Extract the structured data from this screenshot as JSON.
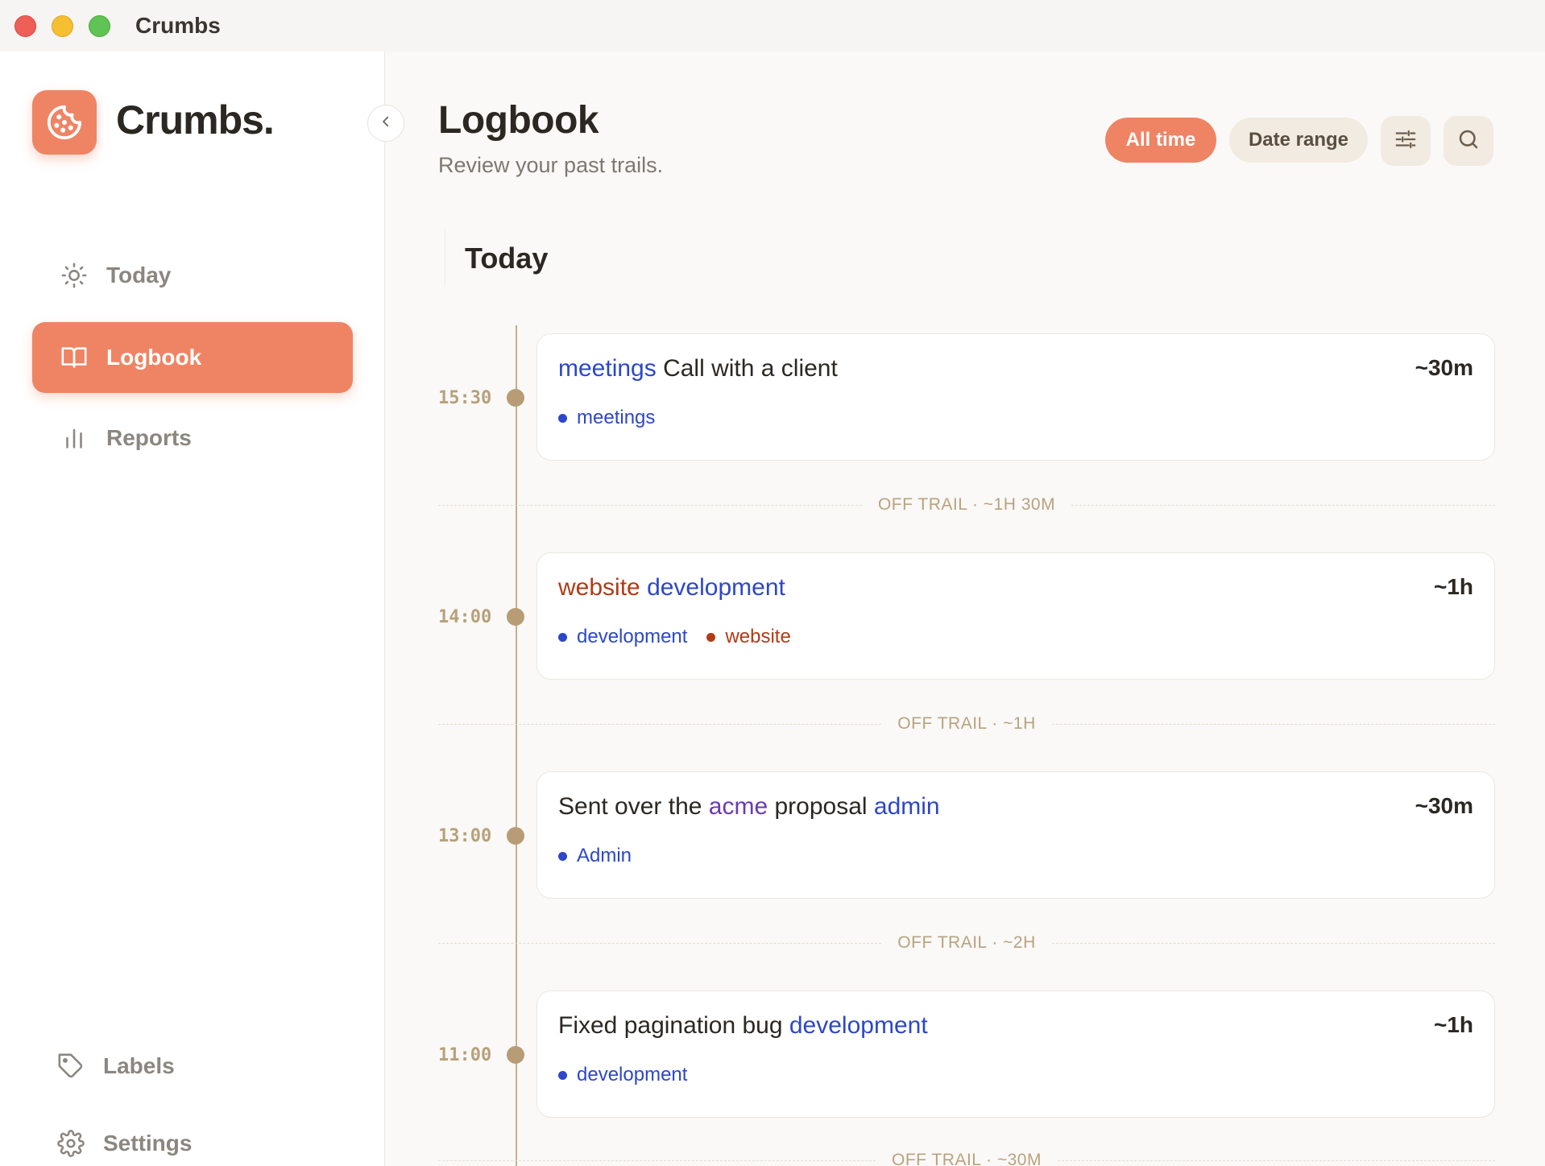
{
  "window": {
    "title": "Crumbs"
  },
  "sidebar": {
    "brand": "Crumbs.",
    "items": [
      {
        "label": "Today",
        "icon": "sun-icon",
        "active": false
      },
      {
        "label": "Logbook",
        "icon": "book-icon",
        "active": true
      },
      {
        "label": "Reports",
        "icon": "bar-chart-icon",
        "active": false
      }
    ],
    "bottom": [
      {
        "label": "Labels",
        "icon": "tag-icon"
      },
      {
        "label": "Settings",
        "icon": "gear-icon"
      }
    ]
  },
  "header": {
    "title": "Logbook",
    "subtitle": "Review your past trails.",
    "filters": {
      "all_time": "All time",
      "date_range": "Date range"
    }
  },
  "section": {
    "title": "Today"
  },
  "entries": [
    {
      "time": "15:30",
      "title_parts": [
        {
          "text": "meetings",
          "color": "blue"
        },
        {
          "text": " Call with a client",
          "color": "default"
        }
      ],
      "duration": "~30m",
      "tags": [
        {
          "label": "meetings",
          "color": "blue"
        }
      ]
    },
    {
      "time": "14:00",
      "title_parts": [
        {
          "text": "website",
          "color": "rust"
        },
        {
          "text": " ",
          "color": "default"
        },
        {
          "text": "development",
          "color": "blue"
        }
      ],
      "duration": "~1h",
      "tags": [
        {
          "label": "development",
          "color": "blue"
        },
        {
          "label": "website",
          "color": "rust"
        }
      ]
    },
    {
      "time": "13:00",
      "title_parts": [
        {
          "text": "Sent over the ",
          "color": "default"
        },
        {
          "text": "acme",
          "color": "purple"
        },
        {
          "text": " proposal ",
          "color": "default"
        },
        {
          "text": "admin",
          "color": "blue"
        }
      ],
      "duration": "~30m",
      "tags": [
        {
          "label": "Admin",
          "color": "blue"
        }
      ]
    },
    {
      "time": "11:00",
      "title_parts": [
        {
          "text": "Fixed pagination bug ",
          "color": "default"
        },
        {
          "text": "development",
          "color": "blue"
        }
      ],
      "duration": "~1h",
      "tags": [
        {
          "label": "development",
          "color": "blue"
        }
      ]
    }
  ],
  "gaps": [
    "OFF TRAIL · ~1H 30M",
    "OFF TRAIL · ~1H",
    "OFF TRAIL · ~2H",
    "OFF TRAIL · ~30M"
  ],
  "colors": {
    "accent": "#ef8464",
    "blue": "#2c47c9",
    "rust": "#b13b16",
    "purple": "#6a3bb0",
    "timeline": "#b89c76"
  }
}
